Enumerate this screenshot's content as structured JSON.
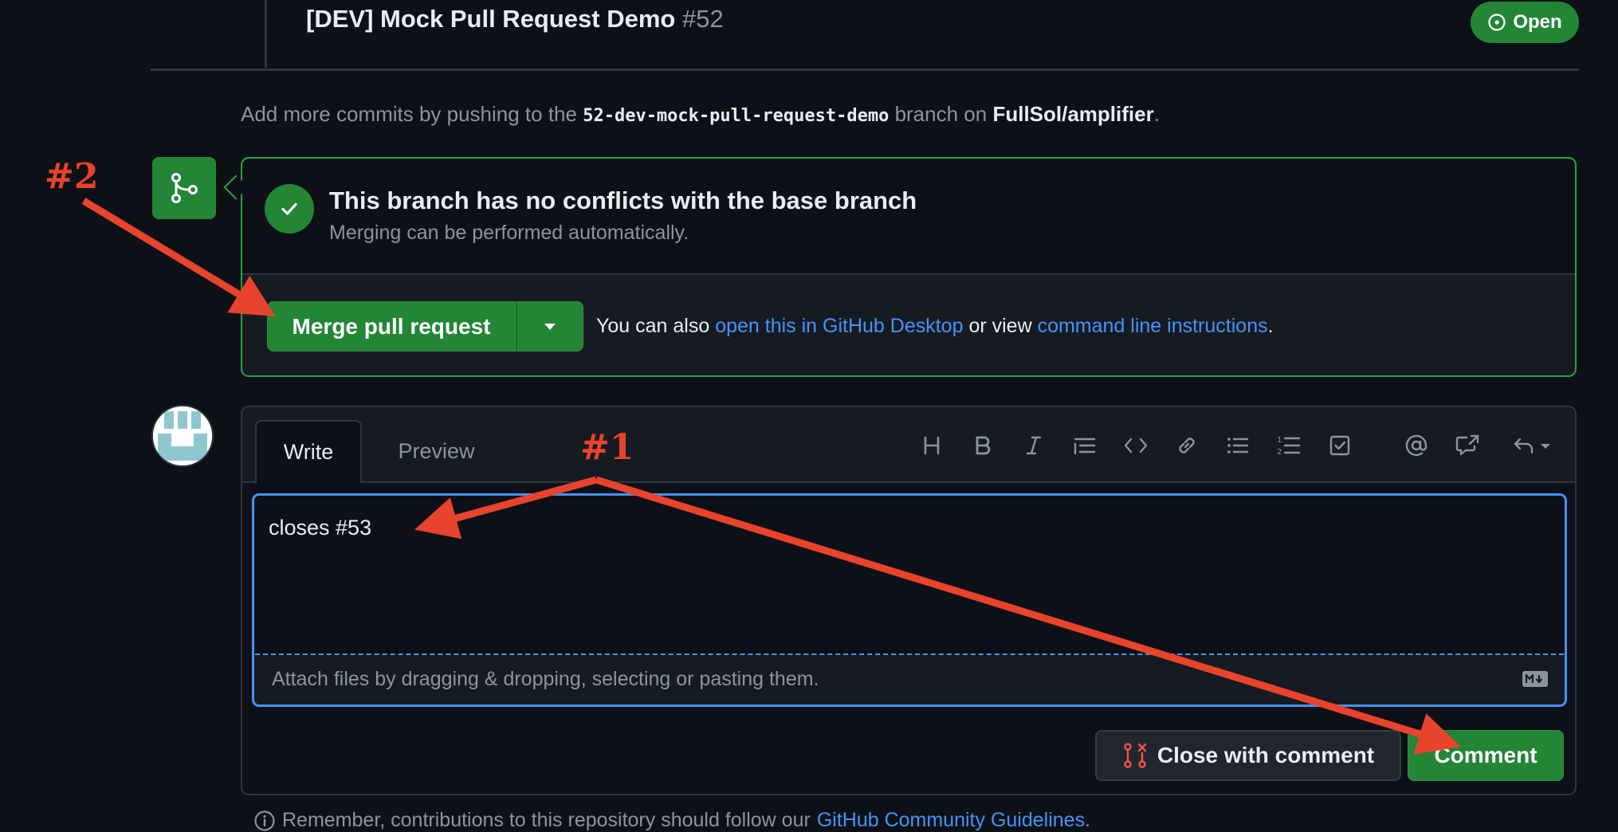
{
  "header": {
    "title": "[DEV] Mock Pull Request Demo",
    "number": "#52",
    "state": "Open"
  },
  "commit_hint": {
    "prefix": "Add more commits by pushing to the",
    "branch": "52-dev-mock-pull-request-demo",
    "middle": "branch on",
    "repo": "FullSol/amplifier",
    "suffix": "."
  },
  "merge": {
    "heading": "This branch has no conflicts with the base branch",
    "subtext": "Merging can be performed automatically.",
    "button_label": "Merge pull request",
    "alt_prefix": "You can also",
    "alt_link_desktop": "open this in GitHub Desktop",
    "alt_middle": "or view",
    "alt_link_cli": "command line instructions",
    "alt_suffix": "."
  },
  "comment": {
    "tabs": [
      "Write",
      "Preview"
    ],
    "toolbar": [
      "heading-icon",
      "bold-icon",
      "italic-icon",
      "quote-icon",
      "code-icon",
      "link-icon",
      "bullet-list-icon",
      "numbered-list-icon",
      "task-list-icon",
      "mention-icon",
      "reference-icon",
      "saved-reply-icon"
    ],
    "body": "closes #53",
    "attach_hint": "Attach files by dragging & dropping, selecting or pasting them.",
    "close_button": "Close with comment",
    "comment_button": "Comment"
  },
  "guidelines": {
    "prefix": "Remember, contributions to this repository should follow our",
    "link": "GitHub Community Guidelines",
    "suffix": "."
  },
  "annotations": {
    "label_1": "#1",
    "label_2": "#2"
  },
  "colors": {
    "background": "#0d1117",
    "success": "#238636",
    "link": "#4493f8",
    "annotation": "#e8432c"
  }
}
